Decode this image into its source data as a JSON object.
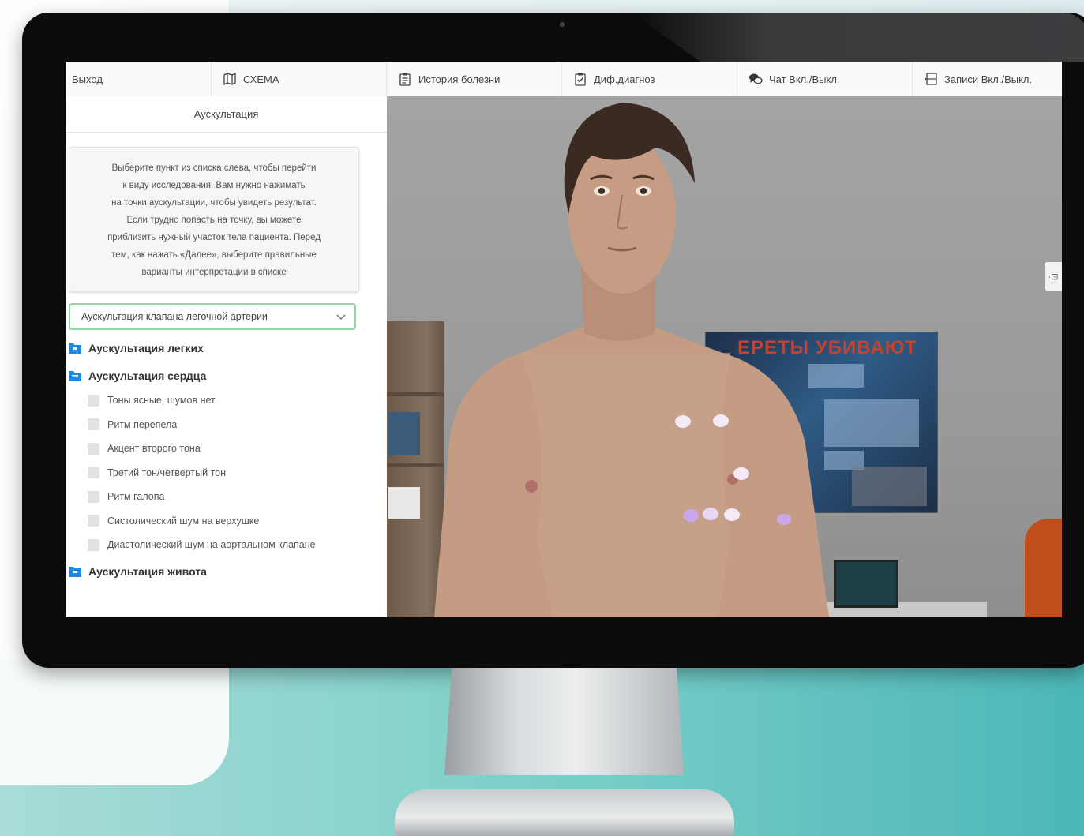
{
  "toolbar": {
    "exit": "Выход",
    "schema": "СХЕМА",
    "history": "История болезни",
    "diff": "Диф.диагноз",
    "chat": "Чат Вкл./Выкл.",
    "notes": "Записи Вкл./Выкл."
  },
  "panel": {
    "title": "Аускультация",
    "instructions": [
      "Выберите пункт из списка слева, чтобы перейти",
      "к виду исследования. Вам нужно нажимать",
      "на точки аускультации, чтобы увидеть результат.",
      "Если трудно попасть на точку, вы можете",
      "приблизить нужный участок тела пациента. Перед",
      "тем, как нажать «Далее», выберите правильные",
      "варианты интерпретации в списке"
    ],
    "select_value": "Аускультация клапана легочной артерии"
  },
  "tree": {
    "lungs": "Аускультация легких",
    "heart": "Аускультация сердца",
    "heart_items": [
      "Тоны ясные, шумов нет",
      "Ритм перепела",
      "Акцент второго тона",
      "Третий тон/четвертый тон",
      "Ритм галопа",
      "Систолический шум на верхушке",
      "Диастолический шум на аортальном клапане"
    ],
    "abdomen": "Аускультация живота"
  },
  "scene": {
    "poster_title": "ЕРЕТЫ УБИВАЮТ",
    "side_handle": "·⊡"
  },
  "colors": {
    "select_border": "#8fd6a4",
    "folder": "#1e88e5",
    "point_light": "#f3eaf6",
    "point_violet": "#c8a8ea"
  },
  "icons": {
    "schema": "map-icon",
    "history": "clipboard-icon",
    "diff": "checklist-icon",
    "chat": "chat-bubbles-icon",
    "notes": "notes-panel-icon",
    "select": "chevron-down-icon",
    "group": "folder-icon"
  }
}
